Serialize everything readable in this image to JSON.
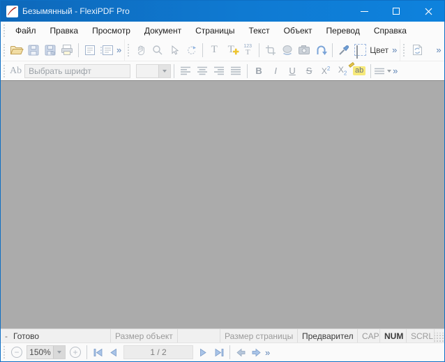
{
  "titlebar": {
    "title": "Безымянный - FlexiPDF Pro"
  },
  "menu": {
    "items": [
      {
        "label": "Файл"
      },
      {
        "label": "Правка"
      },
      {
        "label": "Просмотр"
      },
      {
        "label": "Документ"
      },
      {
        "label": "Страницы"
      },
      {
        "label": "Текст"
      },
      {
        "label": "Объект"
      },
      {
        "label": "Перевод"
      },
      {
        "label": "Справка"
      }
    ]
  },
  "toolbar_main": {
    "overflow": "»",
    "color_label": "Цвет",
    "icons": [
      "open-folder",
      "save",
      "save-as",
      "print",
      "page-view-single",
      "page-view-continuous",
      "hand-tool",
      "zoom-tool",
      "select-cursor",
      "rotate-tool",
      "text-tool",
      "add-text-tool",
      "numbered-text-tool",
      "crop-tool",
      "image-tool",
      "camera-snapshot",
      "reflow-arrow",
      "eyedropper",
      "color-swatch",
      "page-refresh"
    ]
  },
  "toolbar_format": {
    "ab_icon": "Ab",
    "font_placeholder": "Выбрать шрифт",
    "bold": "B",
    "italic": "I",
    "underline": "U",
    "strikethrough": "S",
    "script_base": "X",
    "superscript_exp": "2",
    "subscript_idx": "2",
    "highlight": "ab",
    "overflow": "»",
    "icons": [
      "align-left",
      "align-center",
      "align-right",
      "align-justify",
      "line-spacing"
    ]
  },
  "statusbar": {
    "mode_dash": "-",
    "ready": "Готово",
    "object_size": "Размер объект",
    "page_size": "Размер страницы",
    "preview": "Предварител",
    "caps": "CAP",
    "num": "NUM",
    "scroll": "SCRL"
  },
  "bottombar": {
    "zoom_value": "150%",
    "page_indicator": "1 / 2",
    "overflow": "»",
    "icons": [
      "zoom-out",
      "zoom-in",
      "first-page",
      "previous-page",
      "next-page",
      "last-page",
      "history-back",
      "history-forward"
    ]
  },
  "colors": {
    "titlebar_blue": "#0f7ad2",
    "document_gray": "#ababab",
    "disabled_icon_gray": "#b6bec7",
    "active_arrow_blue": "#7ba4d8",
    "folder_yellow": "#f1dda4",
    "highlight_yellow": "#f6e97a"
  }
}
